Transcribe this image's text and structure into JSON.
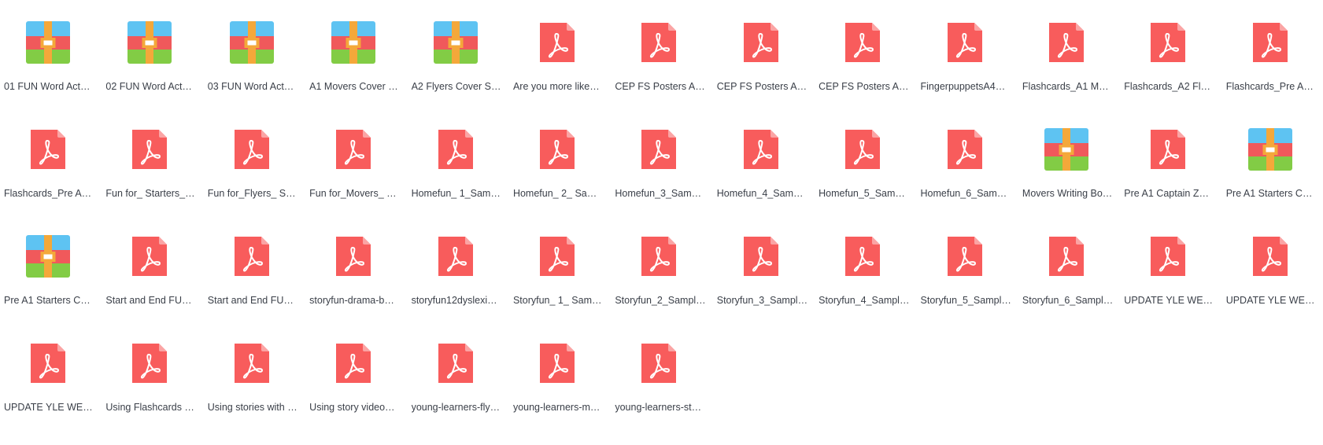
{
  "colors": {
    "pdf_red": "#f85c5c",
    "pdf_fold": "#fba4a4",
    "archive_blue": "#5ec3f2",
    "archive_red": "#f0595b",
    "archive_green": "#82cc45",
    "archive_belt": "#f4a83a",
    "label_text": "#3a3f48"
  },
  "files": [
    {
      "name": "01 FUN Word Act…",
      "type": "archive",
      "icon": "archive-icon"
    },
    {
      "name": "02 FUN Word Act…",
      "type": "archive",
      "icon": "archive-icon"
    },
    {
      "name": "03 FUN Word Act…",
      "type": "archive",
      "icon": "archive-icon"
    },
    {
      "name": "A1 Movers Cover …",
      "type": "archive",
      "icon": "archive-icon"
    },
    {
      "name": "A2 Flyers Cover S…",
      "type": "archive",
      "icon": "archive-icon"
    },
    {
      "name": "Are you more like…",
      "type": "pdf",
      "icon": "pdf-icon"
    },
    {
      "name": "CEP FS Posters A…",
      "type": "pdf",
      "icon": "pdf-icon"
    },
    {
      "name": "CEP FS Posters A…",
      "type": "pdf",
      "icon": "pdf-icon"
    },
    {
      "name": "CEP FS Posters A…",
      "type": "pdf",
      "icon": "pdf-icon"
    },
    {
      "name": "FingerpuppetsA4…",
      "type": "pdf",
      "icon": "pdf-icon"
    },
    {
      "name": "Flashcards_A1 M…",
      "type": "pdf",
      "icon": "pdf-icon"
    },
    {
      "name": "Flashcards_A2 Fl…",
      "type": "pdf",
      "icon": "pdf-icon"
    },
    {
      "name": "Flashcards_Pre A…",
      "type": "pdf",
      "icon": "pdf-icon"
    },
    {
      "name": "Flashcards_Pre A…",
      "type": "pdf",
      "icon": "pdf-icon"
    },
    {
      "name": "Fun for_ Starters_…",
      "type": "pdf",
      "icon": "pdf-icon"
    },
    {
      "name": "Fun for_Flyers_ S…",
      "type": "pdf",
      "icon": "pdf-icon"
    },
    {
      "name": "Fun for_Movers_ …",
      "type": "pdf",
      "icon": "pdf-icon"
    },
    {
      "name": "Homefun_ 1_Sam…",
      "type": "pdf",
      "icon": "pdf-icon"
    },
    {
      "name": "Homefun_ 2_ Sa…",
      "type": "pdf",
      "icon": "pdf-icon"
    },
    {
      "name": "Homefun_3_Sam…",
      "type": "pdf",
      "icon": "pdf-icon"
    },
    {
      "name": "Homefun_4_Sam…",
      "type": "pdf",
      "icon": "pdf-icon"
    },
    {
      "name": "Homefun_5_Sam…",
      "type": "pdf",
      "icon": "pdf-icon"
    },
    {
      "name": "Homefun_6_Sam…",
      "type": "pdf",
      "icon": "pdf-icon"
    },
    {
      "name": "Movers Writing Bo…",
      "type": "archive",
      "icon": "archive-icon"
    },
    {
      "name": "Pre A1 Captain Z…",
      "type": "pdf",
      "icon": "pdf-icon"
    },
    {
      "name": "Pre A1 Starters C…",
      "type": "archive",
      "icon": "archive-icon"
    },
    {
      "name": "Pre A1 Starters C…",
      "type": "archive",
      "icon": "archive-icon"
    },
    {
      "name": "Start and End FU…",
      "type": "pdf",
      "icon": "pdf-icon"
    },
    {
      "name": "Start and End FU…",
      "type": "pdf",
      "icon": "pdf-icon"
    },
    {
      "name": "storyfun-drama-b…",
      "type": "pdf",
      "icon": "pdf-icon"
    },
    {
      "name": "storyfun12dyslexi…",
      "type": "pdf",
      "icon": "pdf-icon"
    },
    {
      "name": "Storyfun_ 1_ Sam…",
      "type": "pdf",
      "icon": "pdf-icon"
    },
    {
      "name": "Storyfun_2_Sampl…",
      "type": "pdf",
      "icon": "pdf-icon"
    },
    {
      "name": "Storyfun_3_Sampl…",
      "type": "pdf",
      "icon": "pdf-icon"
    },
    {
      "name": "Storyfun_4_Sampl…",
      "type": "pdf",
      "icon": "pdf-icon"
    },
    {
      "name": "Storyfun_5_Sampl…",
      "type": "pdf",
      "icon": "pdf-icon"
    },
    {
      "name": "Storyfun_6_Sampl…",
      "type": "pdf",
      "icon": "pdf-icon"
    },
    {
      "name": "UPDATE YLE WE…",
      "type": "pdf",
      "icon": "pdf-icon"
    },
    {
      "name": "UPDATE YLE WE…",
      "type": "pdf",
      "icon": "pdf-icon"
    },
    {
      "name": "UPDATE YLE WE…",
      "type": "pdf",
      "icon": "pdf-icon"
    },
    {
      "name": "Using Flashcards …",
      "type": "pdf",
      "icon": "pdf-icon"
    },
    {
      "name": "Using stories with …",
      "type": "pdf",
      "icon": "pdf-icon"
    },
    {
      "name": "Using story video…",
      "type": "pdf",
      "icon": "pdf-icon"
    },
    {
      "name": "young-learners-fly…",
      "type": "pdf",
      "icon": "pdf-icon"
    },
    {
      "name": "young-learners-m…",
      "type": "pdf",
      "icon": "pdf-icon"
    },
    {
      "name": "young-learners-st…",
      "type": "pdf",
      "icon": "pdf-icon"
    }
  ]
}
